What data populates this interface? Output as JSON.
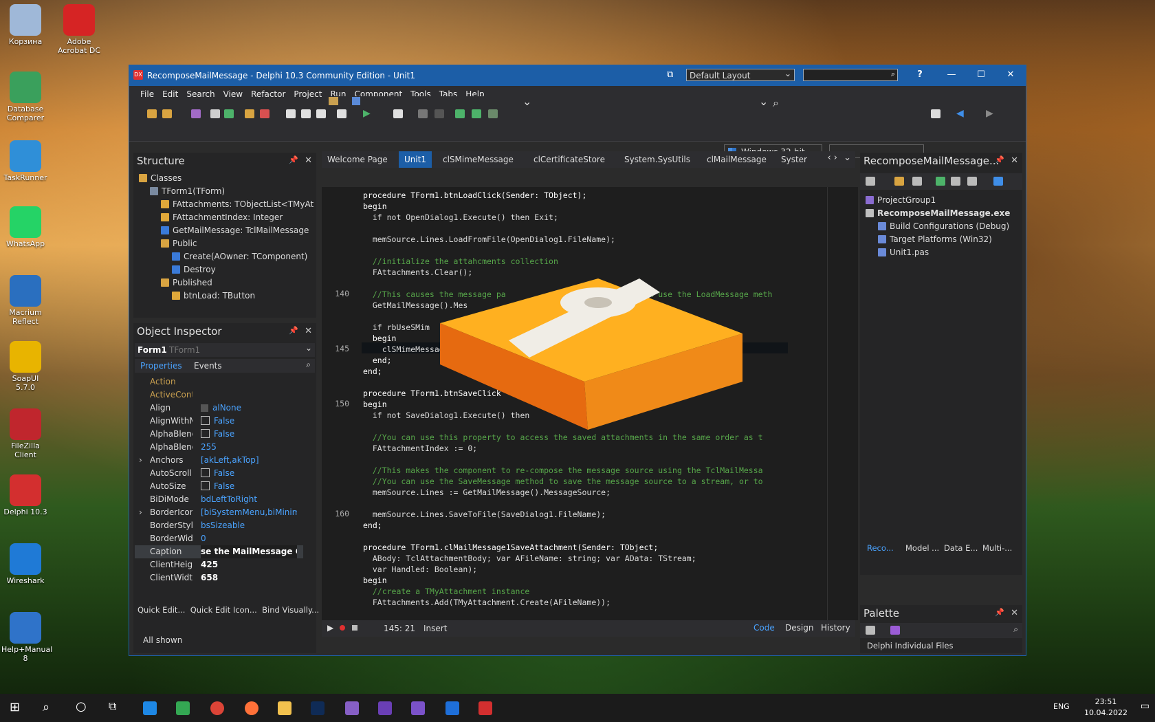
{
  "desktop_icons": [
    {
      "label": "Корзина",
      "color": "#9fb8d8"
    },
    {
      "label": "Adobe Acrobat DC",
      "color": "#d62424"
    },
    {
      "label": "Database Comparer",
      "color": "#3aa05c"
    },
    {
      "label": "TaskRunner",
      "color": "#2f8fd8"
    },
    {
      "label": "WhatsApp",
      "color": "#25d366"
    },
    {
      "label": "Macrium Reflect",
      "color": "#2a6fbf"
    },
    {
      "label": "SoapUI 5.7.0",
      "color": "#e8b400"
    },
    {
      "label": "FileZilla Client",
      "color": "#c0262d"
    },
    {
      "label": "Delphi 10.3",
      "color": "#d32f2f"
    },
    {
      "label": "Wireshark",
      "color": "#1f7ad6"
    },
    {
      "label": "Help+Manual 8",
      "color": "#2f73c9"
    }
  ],
  "window": {
    "title": "RecomposeMailMessage - Delphi 10.3 Community Edition - Unit1",
    "logo": "DX",
    "layout": "Default Layout",
    "help": "?"
  },
  "menu": [
    "File",
    "Edit",
    "Search",
    "View",
    "Refactor",
    "Project",
    "Run",
    "Component",
    "Tools",
    "Tabs",
    "Help"
  ],
  "toolbar": {
    "platform": "Windows 32-bit"
  },
  "structure": {
    "title": "Structure",
    "items": [
      {
        "label": "Classes",
        "icon": "folder-icon",
        "indent": 0
      },
      {
        "label": "TForm1(TForm)",
        "icon": "class-icon",
        "indent": 1
      },
      {
        "label": "FAttachments: TObjectList<TMyAt",
        "icon": "field-icon",
        "indent": 2
      },
      {
        "label": "FAttachmentIndex: Integer",
        "icon": "field-icon",
        "indent": 2
      },
      {
        "label": "GetMailMessage: TclMailMessage",
        "icon": "method-icon",
        "indent": 2
      },
      {
        "label": "Public",
        "icon": "folder-icon",
        "indent": 2
      },
      {
        "label": "Create(AOwner: TComponent)",
        "icon": "method-icon",
        "indent": 3
      },
      {
        "label": "Destroy",
        "icon": "method-icon",
        "indent": 3
      },
      {
        "label": "Published",
        "icon": "folder-icon",
        "indent": 2
      },
      {
        "label": "btnLoad: TButton",
        "icon": "field-icon",
        "indent": 3
      }
    ]
  },
  "object_inspector": {
    "title": "Object Inspector",
    "object": "Form1",
    "object_type": "TForm1",
    "tabs": [
      "Properties",
      "Events"
    ],
    "rows": [
      {
        "k": "Action",
        "v": "",
        "cb": false,
        "muted": true
      },
      {
        "k": "ActiveControl",
        "v": "",
        "cb": false,
        "muted": true
      },
      {
        "k": "Align",
        "v": "alNone",
        "cb": false,
        "dot": true
      },
      {
        "k": "AlignWithMargins",
        "v": "False",
        "cb": true
      },
      {
        "k": "AlphaBlend",
        "v": "False",
        "cb": true
      },
      {
        "k": "AlphaBlendValue",
        "v": "255",
        "cb": false
      },
      {
        "k": "Anchors",
        "v": "[akLeft,akTop]",
        "cb": false,
        "exp": true
      },
      {
        "k": "AutoScroll",
        "v": "False",
        "cb": true
      },
      {
        "k": "AutoSize",
        "v": "False",
        "cb": true
      },
      {
        "k": "BiDiMode",
        "v": "bdLeftToRight",
        "cb": false
      },
      {
        "k": "BorderIcons",
        "v": "[biSystemMenu,biMinimize",
        "cb": false,
        "exp": true
      },
      {
        "k": "BorderStyle",
        "v": "bsSizeable",
        "cb": false
      },
      {
        "k": "BorderWidth",
        "v": "0",
        "cb": false
      },
      {
        "k": "Caption",
        "v": "se the MailMessage Conter",
        "cb": false,
        "sel": true
      },
      {
        "k": "ClientHeight",
        "v": "425",
        "cb": false,
        "bold": true
      },
      {
        "k": "ClientWidth",
        "v": "658",
        "cb": false,
        "bold": true
      }
    ],
    "links": "Quick Edit...  Quick Edit Icon...  Bind Visually...",
    "footer": "All shown"
  },
  "editor": {
    "tabs": [
      "Welcome Page",
      "Unit1",
      "clSMimeMessage",
      "clCertificateStore",
      "System.SysUtils",
      "clMailMessage",
      "Syster"
    ],
    "active_tab": 1,
    "lines": [
      {
        "n": "",
        "t": "procedure TForm1.btnLoadClick(Sender: TObject);",
        "c": "kw"
      },
      {
        "n": "",
        "t": "begin",
        "c": "kw"
      },
      {
        "n": "",
        "t": "  if not OpenDialog1.Execute() then Exit;",
        "c": ""
      },
      {
        "n": "",
        "t": "",
        "c": ""
      },
      {
        "n": "",
        "t": "  memSource.Lines.LoadFromFile(OpenDialog1.FileName);",
        "c": ""
      },
      {
        "n": "",
        "t": "",
        "c": ""
      },
      {
        "n": "",
        "t": "  //initialize the attahcments collection",
        "c": "cm"
      },
      {
        "n": "",
        "t": "  FAttachments.Clear();",
        "c": ""
      },
      {
        "n": "",
        "t": "",
        "c": ""
      },
      {
        "n": "140",
        "t": "  //This causes the message pa                          u can use the LoadMessage meth",
        "c": "cm"
      },
      {
        "n": "",
        "t": "  GetMailMessage().Mes",
        "c": ""
      },
      {
        "n": "",
        "t": "",
        "c": ""
      },
      {
        "n": "",
        "t": "  if rbUseSMim",
        "c": ""
      },
      {
        "n": "",
        "t": "  begin",
        "c": "kw"
      },
      {
        "n": "145",
        "t": "    clSMimeMessag",
        "c": ""
      },
      {
        "n": "",
        "t": "  end;",
        "c": "kw"
      },
      {
        "n": "",
        "t": "end;",
        "c": "kw"
      },
      {
        "n": "",
        "t": "",
        "c": ""
      },
      {
        "n": "",
        "t": "procedure TForm1.btnSaveClick",
        "c": "kw"
      },
      {
        "n": "150",
        "t": "begin",
        "c": "kw"
      },
      {
        "n": "",
        "t": "  if not SaveDialog1.Execute() then",
        "c": ""
      },
      {
        "n": "",
        "t": "",
        "c": ""
      },
      {
        "n": "",
        "t": "  //You can use this property to access the saved attachments in the same order as t",
        "c": "cm"
      },
      {
        "n": "",
        "t": "  FAttachmentIndex := 0;",
        "c": ""
      },
      {
        "n": "",
        "t": "",
        "c": ""
      },
      {
        "n": "",
        "t": "  //This makes the component to re-compose the message source using the TclMailMessa",
        "c": "cm"
      },
      {
        "n": "",
        "t": "  //You can use the SaveMessage method to save the message source to a stream, or to",
        "c": "cm"
      },
      {
        "n": "",
        "t": "  memSource.Lines := GetMailMessage().MessageSource;",
        "c": ""
      },
      {
        "n": "",
        "t": "",
        "c": ""
      },
      {
        "n": "160",
        "t": "  memSource.Lines.SaveToFile(SaveDialog1.FileName);",
        "c": ""
      },
      {
        "n": "",
        "t": "end;",
        "c": "kw"
      },
      {
        "n": "",
        "t": "",
        "c": ""
      },
      {
        "n": "",
        "t": "procedure TForm1.clMailMessage1SaveAttachment(Sender: TObject;",
        "c": "kw"
      },
      {
        "n": "",
        "t": "  ABody: TclAttachmentBody; var AFileName: string; var AData: TStream;",
        "c": ""
      },
      {
        "n": "",
        "t": "  var Handled: Boolean);",
        "c": ""
      },
      {
        "n": "",
        "t": "begin",
        "c": "kw"
      },
      {
        "n": "",
        "t": "  //create a TMyAttachment instance",
        "c": "cm"
      },
      {
        "n": "",
        "t": "  FAttachments.Add(TMyAttachment.Create(AFileName));",
        "c": ""
      }
    ],
    "status": {
      "position": "145: 21",
      "mode": "Insert",
      "views": [
        "Code",
        "Design",
        "History"
      ]
    }
  },
  "project": {
    "title": "RecomposeMailMessage...",
    "items": [
      {
        "label": "ProjectGroup1",
        "indent": 0,
        "bold": false
      },
      {
        "label": "RecomposeMailMessage.exe",
        "indent": 0,
        "bold": true
      },
      {
        "label": "Build Configurations (Debug)",
        "indent": 1,
        "bold": false
      },
      {
        "label": "Target Platforms (Win32)",
        "indent": 1,
        "bold": false
      },
      {
        "label": "Unit1.pas",
        "indent": 1,
        "bold": false
      }
    ],
    "tabs": [
      "Reco...",
      "Model ...",
      "Data E...",
      "Multi-..."
    ]
  },
  "palette": {
    "title": "Palette",
    "item": "Delphi Individual Files"
  },
  "taskbar": {
    "lang": "ENG",
    "time": "23:51",
    "date": "10.04.2022"
  }
}
